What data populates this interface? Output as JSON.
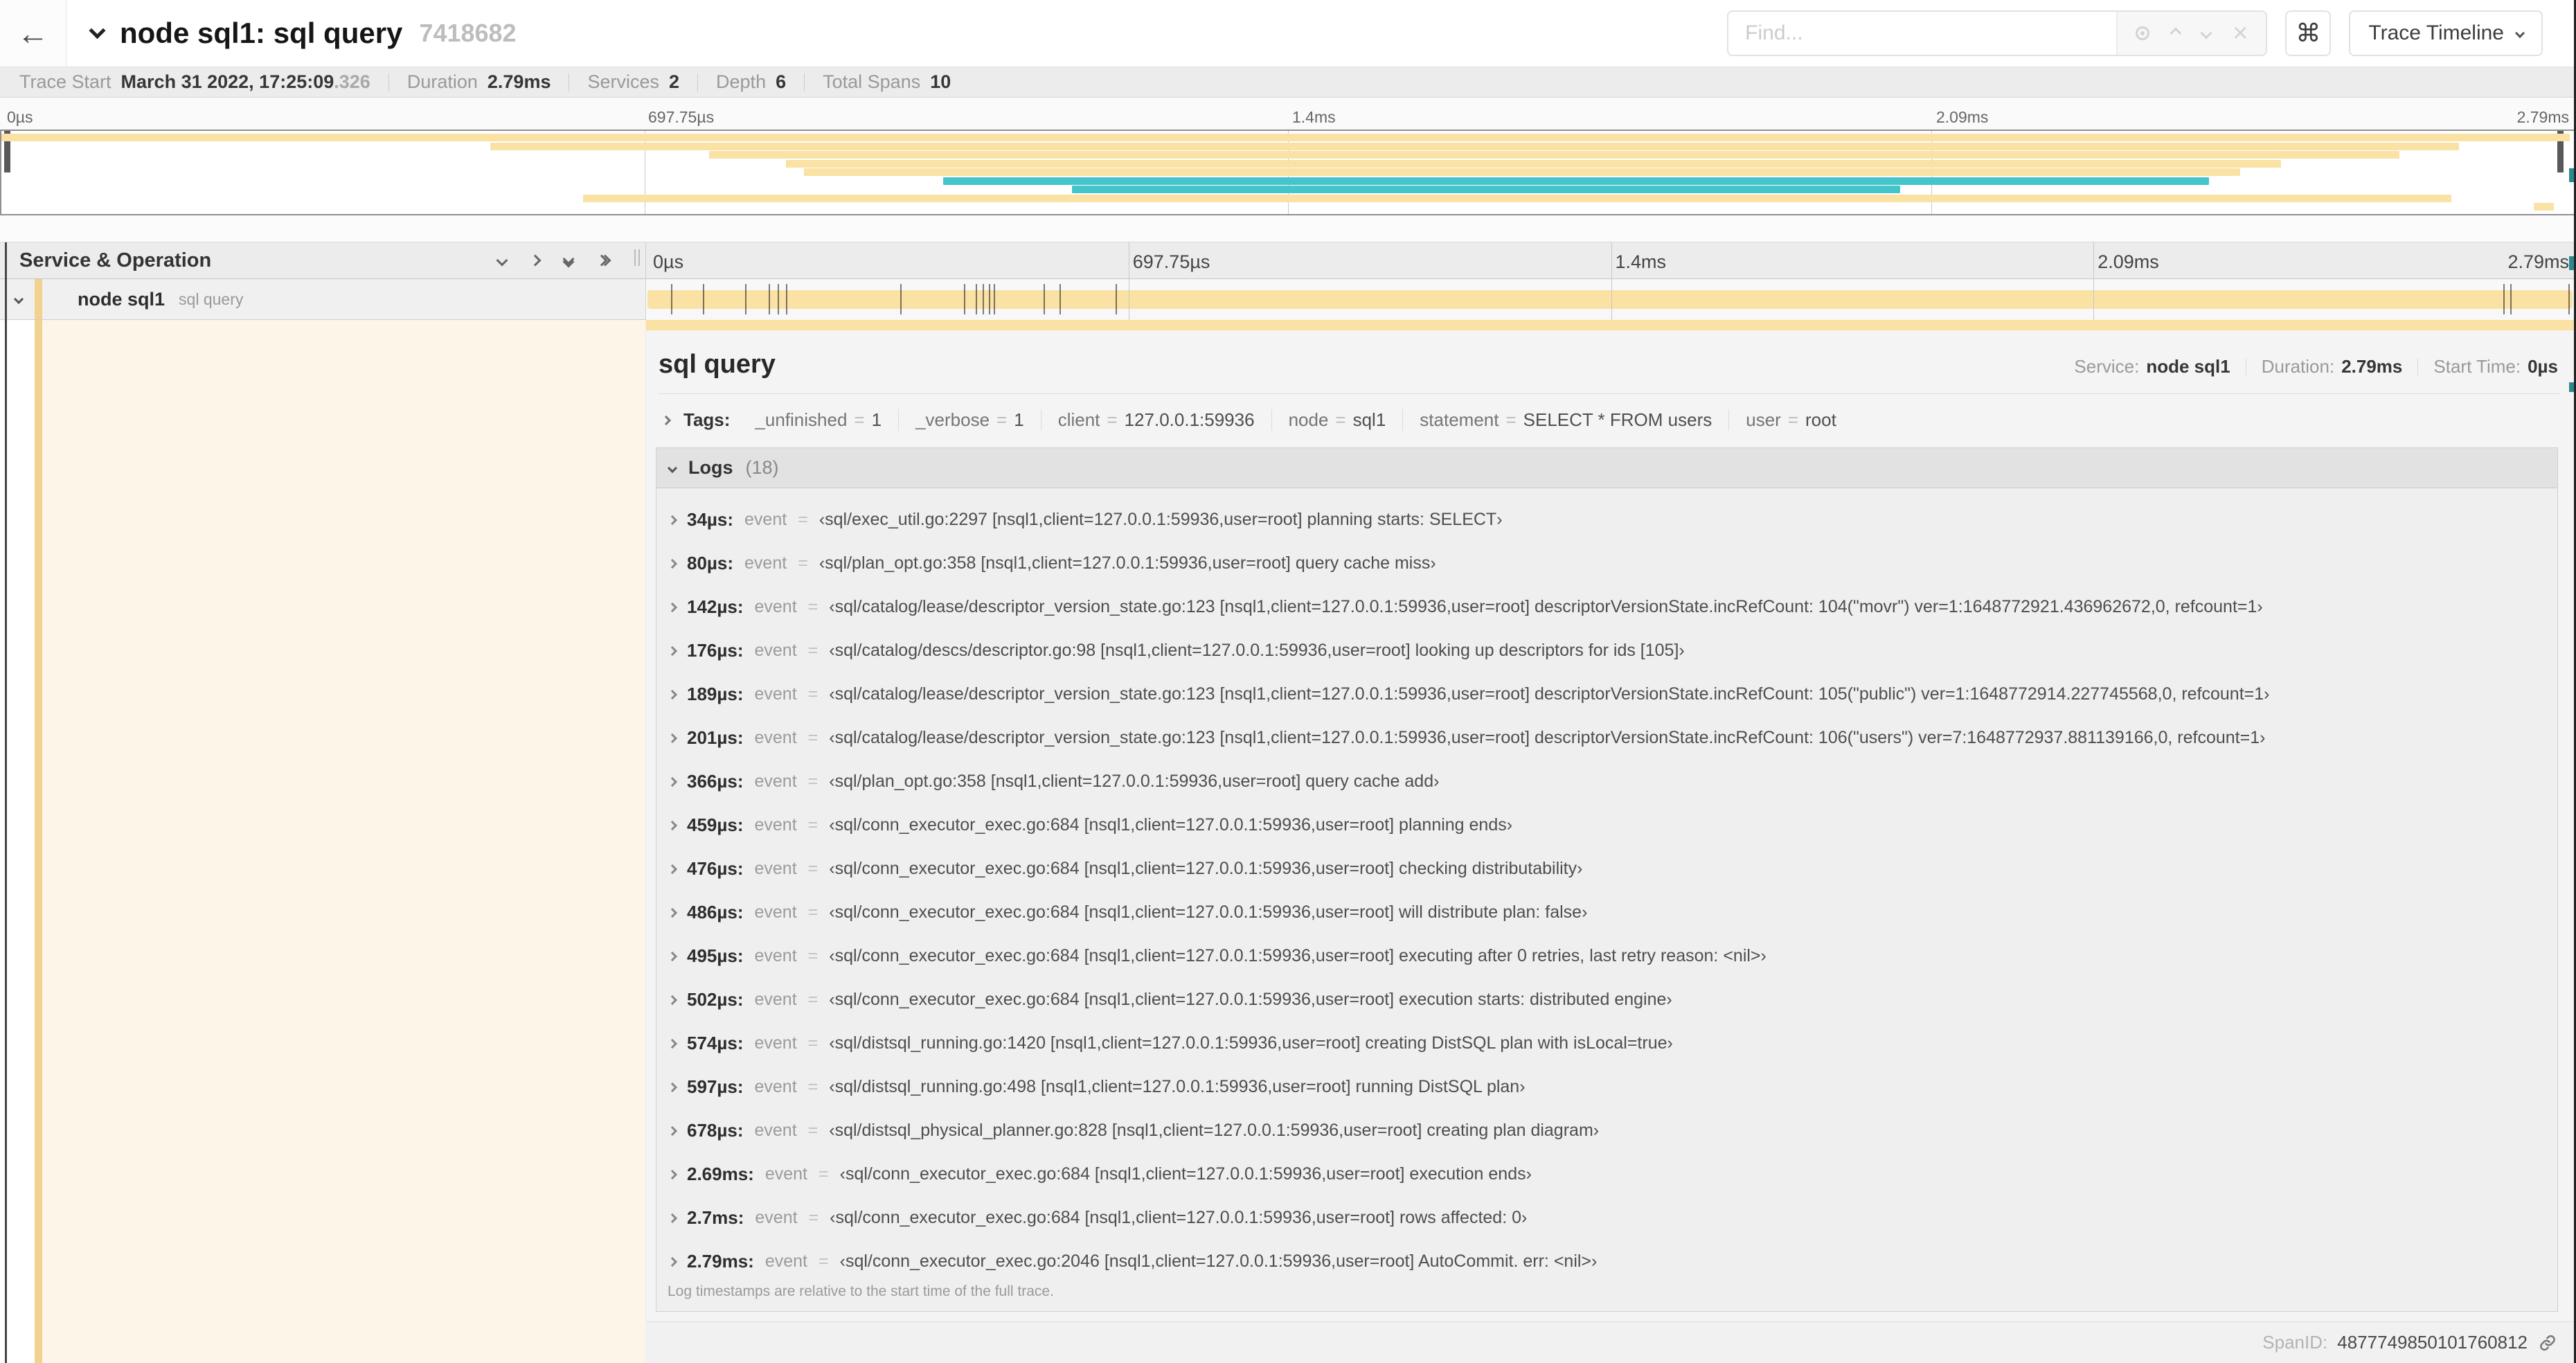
{
  "colors": {
    "tan": "#fae1a4",
    "teal": "#44c5c9",
    "stripe": "#f2d28f",
    "cream": "#fdf6e8"
  },
  "header": {
    "back_icon": "←",
    "title": "node sql1: sql query",
    "trace_id": "7418682",
    "find_placeholder": "Find...",
    "shortcut_key": "⌘",
    "view_selector_label": "Trace Timeline"
  },
  "trace_stats": {
    "trace_start_label": "Trace Start",
    "trace_start_value": "March 31 2022, 17:25:09",
    "trace_start_fraction": ".326",
    "duration_label": "Duration",
    "duration_value": "2.79ms",
    "services_label": "Services",
    "services_value": "2",
    "depth_label": "Depth",
    "depth_value": "6",
    "total_spans_label": "Total Spans",
    "total_spans_value": "10"
  },
  "timeline": {
    "duration_us": 2790,
    "ticks": [
      "0µs",
      "697.75µs",
      "1.4ms",
      "2.09ms",
      "2.79ms"
    ]
  },
  "minimap": {
    "spans": [
      {
        "start": 0,
        "end": 99.8,
        "color": "tan"
      },
      {
        "start": 19,
        "end": 95.5,
        "color": "tan"
      },
      {
        "start": 27.5,
        "end": 93.2,
        "color": "tan"
      },
      {
        "start": 30.5,
        "end": 88.6,
        "color": "tan"
      },
      {
        "start": 31.2,
        "end": 87,
        "color": "tan"
      },
      {
        "start": 36.6,
        "end": 85.8,
        "color": "teal"
      },
      {
        "start": 41.6,
        "end": 73.8,
        "color": "teal"
      },
      {
        "start": 22.6,
        "end": 95.2,
        "color": "tan"
      },
      {
        "start": 98.4,
        "end": 99.2,
        "color": "tan"
      }
    ]
  },
  "span_table": {
    "header_label": "Service & Operation",
    "row": {
      "service": "node sql1",
      "operation": "sql query"
    }
  },
  "detail": {
    "title": "sql query",
    "service_label": "Service:",
    "service_value": "node sql1",
    "duration_label": "Duration:",
    "duration_value": "2.79ms",
    "start_label": "Start Time:",
    "start_value": "0µs",
    "tags_label": "Tags:",
    "tags": [
      {
        "key": "_unfinished",
        "value": "1"
      },
      {
        "key": "_verbose",
        "value": "1"
      },
      {
        "key": "client",
        "value": "127.0.0.1:59936"
      },
      {
        "key": "node",
        "value": "sql1"
      },
      {
        "key": "statement",
        "value": "SELECT * FROM users"
      },
      {
        "key": "user",
        "value": "root"
      }
    ],
    "logs_label": "Logs",
    "logs_count": "(18)",
    "logs": [
      {
        "time": "34µs:",
        "us": 34,
        "field": "event",
        "value": "‹sql/exec_util.go:2297 [nsql1,client=127.0.0.1:59936,user=root] planning starts: SELECT›"
      },
      {
        "time": "80µs:",
        "us": 80,
        "field": "event",
        "value": "‹sql/plan_opt.go:358 [nsql1,client=127.0.0.1:59936,user=root] query cache miss›"
      },
      {
        "time": "142µs:",
        "us": 142,
        "field": "event",
        "value": "‹sql/catalog/lease/descriptor_version_state.go:123 [nsql1,client=127.0.0.1:59936,user=root] descriptorVersionState.incRefCount: 104(\"movr\") ver=1:1648772921.436962672,0, refcount=1›"
      },
      {
        "time": "176µs:",
        "us": 176,
        "field": "event",
        "value": "‹sql/catalog/descs/descriptor.go:98 [nsql1,client=127.0.0.1:59936,user=root] looking up descriptors for ids [105]›"
      },
      {
        "time": "189µs:",
        "us": 189,
        "field": "event",
        "value": "‹sql/catalog/lease/descriptor_version_state.go:123 [nsql1,client=127.0.0.1:59936,user=root] descriptorVersionState.incRefCount: 105(\"public\") ver=1:1648772914.227745568,0, refcount=1›"
      },
      {
        "time": "201µs:",
        "us": 201,
        "field": "event",
        "value": "‹sql/catalog/lease/descriptor_version_state.go:123 [nsql1,client=127.0.0.1:59936,user=root] descriptorVersionState.incRefCount: 106(\"users\") ver=7:1648772937.881139166,0, refcount=1›"
      },
      {
        "time": "366µs:",
        "us": 366,
        "field": "event",
        "value": "‹sql/plan_opt.go:358 [nsql1,client=127.0.0.1:59936,user=root] query cache add›"
      },
      {
        "time": "459µs:",
        "us": 459,
        "field": "event",
        "value": "‹sql/conn_executor_exec.go:684 [nsql1,client=127.0.0.1:59936,user=root] planning ends›"
      },
      {
        "time": "476µs:",
        "us": 476,
        "field": "event",
        "value": "‹sql/conn_executor_exec.go:684 [nsql1,client=127.0.0.1:59936,user=root] checking distributability›"
      },
      {
        "time": "486µs:",
        "us": 486,
        "field": "event",
        "value": "‹sql/conn_executor_exec.go:684 [nsql1,client=127.0.0.1:59936,user=root] will distribute plan: false›"
      },
      {
        "time": "495µs:",
        "us": 495,
        "field": "event",
        "value": "‹sql/conn_executor_exec.go:684 [nsql1,client=127.0.0.1:59936,user=root] executing after 0 retries, last retry reason: <nil>›"
      },
      {
        "time": "502µs:",
        "us": 502,
        "field": "event",
        "value": "‹sql/conn_executor_exec.go:684 [nsql1,client=127.0.0.1:59936,user=root] execution starts: distributed engine›"
      },
      {
        "time": "574µs:",
        "us": 574,
        "field": "event",
        "value": "‹sql/distsql_running.go:1420 [nsql1,client=127.0.0.1:59936,user=root] creating DistSQL plan with isLocal=true›"
      },
      {
        "time": "597µs:",
        "us": 597,
        "field": "event",
        "value": "‹sql/distsql_running.go:498 [nsql1,client=127.0.0.1:59936,user=root] running DistSQL plan›"
      },
      {
        "time": "678µs:",
        "us": 678,
        "field": "event",
        "value": "‹sql/distsql_physical_planner.go:828 [nsql1,client=127.0.0.1:59936,user=root] creating plan diagram›"
      },
      {
        "time": "2.69ms:",
        "us": 2690,
        "field": "event",
        "value": "‹sql/conn_executor_exec.go:684 [nsql1,client=127.0.0.1:59936,user=root] execution ends›"
      },
      {
        "time": "2.7ms:",
        "us": 2700,
        "field": "event",
        "value": "‹sql/conn_executor_exec.go:684 [nsql1,client=127.0.0.1:59936,user=root] rows affected: 0›"
      },
      {
        "time": "2.79ms:",
        "us": 2790,
        "field": "event",
        "value": "‹sql/conn_executor_exec.go:2046 [nsql1,client=127.0.0.1:59936,user=root] AutoCommit. err: <nil>›"
      }
    ],
    "logs_footer": "Log timestamps are relative to the start time of the full trace.",
    "spanid_label": "SpanID:",
    "spanid_value": "4877749850101760812"
  }
}
